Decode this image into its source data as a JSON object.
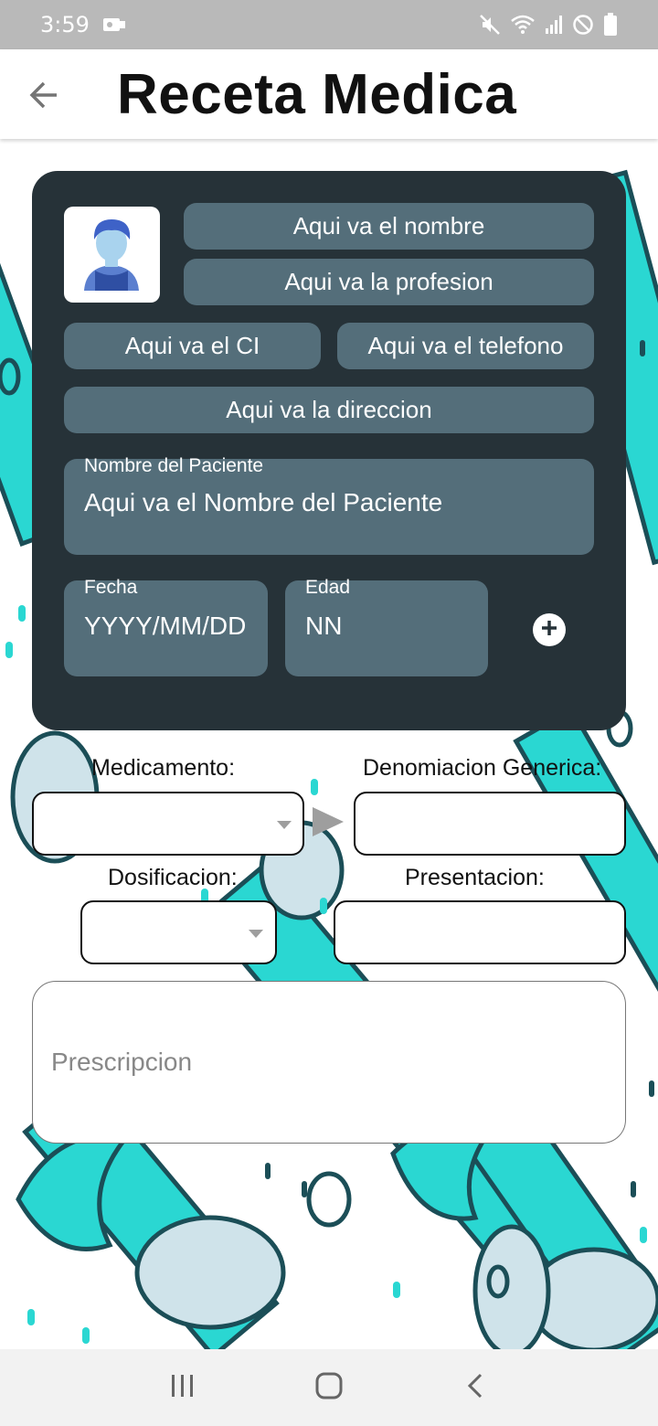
{
  "status_bar": {
    "time": "3:59",
    "left_icons": [
      "notification-icon"
    ],
    "right_icons": [
      "mute-icon",
      "wifi-icon",
      "signal-icon",
      "dnd-icon",
      "battery-icon"
    ]
  },
  "app_bar": {
    "title": "Receta Medica",
    "back_icon": "back-arrow-icon"
  },
  "doctor_card": {
    "avatar_icon": "person-avatar-icon",
    "nombre": "Aqui va el nombre",
    "profesion": "Aqui va la profesion",
    "ci": "Aqui va el CI",
    "telefono": "Aqui va el telefono",
    "direccion": "Aqui va la direccion",
    "paciente_label": "Nombre del Paciente",
    "paciente_value": "Aqui va el Nombre del Paciente",
    "fecha_label": "Fecha",
    "fecha_value": "YYYY/MM/DD",
    "edad_label": "Edad",
    "edad_value": "NN",
    "add_icon": "plus-circle-icon"
  },
  "form": {
    "medicamento_label": "Medicamento:",
    "medicamento_value": "",
    "denominacion_label": "Denomiacion Generica:",
    "denominacion_value": "",
    "dosificacion_label": "Dosificacion:",
    "dosificacion_value": "",
    "presentacion_label": "Presentacion:",
    "presentacion_value": "",
    "prescripcion_placeholder": "Prescripcion"
  },
  "nav_bar": {
    "icons": [
      "recents-icon",
      "home-icon",
      "back-icon"
    ]
  },
  "colors": {
    "card_bg": "#263238",
    "pill_bg": "#546e7a",
    "pattern_teal": "#2ad7d2",
    "pattern_dark": "#1b4e57"
  }
}
